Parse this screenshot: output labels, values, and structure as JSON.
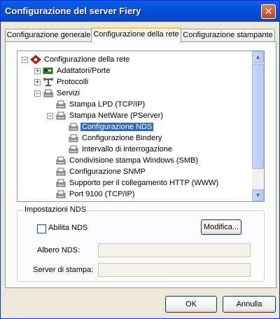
{
  "window": {
    "title": "Configurazione del server Fiery",
    "close_glyph": "✕"
  },
  "tabs": [
    {
      "label": "Configurazione generale"
    },
    {
      "label": "Configurazione della rete"
    },
    {
      "label": "Configurazione stampante"
    }
  ],
  "active_tab": 1,
  "tree": {
    "nodes": [
      {
        "label": "Configurazione della rete",
        "icon": "network-root-icon",
        "level": 0,
        "expander": "minus"
      },
      {
        "label": "Adattatori/Porte",
        "icon": "adapter-card-icon",
        "level": 1,
        "expander": "plus"
      },
      {
        "label": "Protocolli",
        "icon": "protocol-icon",
        "level": 1,
        "expander": "plus"
      },
      {
        "label": "Servizi",
        "icon": "services-icon",
        "level": 1,
        "expander": "minus"
      },
      {
        "label": "Stampa LPD (TCP/IP)",
        "icon": "printer-service-icon",
        "level": 2,
        "expander": ""
      },
      {
        "label": "Stampa NetWare (PServer)",
        "icon": "printer-service-icon",
        "level": 2,
        "expander": "minus"
      },
      {
        "label": "Configurazione NDS",
        "icon": "printer-service-icon",
        "level": 3,
        "expander": "",
        "selected": true
      },
      {
        "label": "Configurazione Bindery",
        "icon": "printer-service-icon",
        "level": 3,
        "expander": ""
      },
      {
        "label": "Intervallo di interrogazione",
        "icon": "printer-service-icon",
        "level": 3,
        "expander": ""
      },
      {
        "label": "Condivisione stampa Windows (SMB)",
        "icon": "printer-service-icon",
        "level": 2,
        "expander": ""
      },
      {
        "label": "Configurazione SNMP",
        "icon": "printer-service-icon",
        "level": 2,
        "expander": ""
      },
      {
        "label": "Supporto per il collegamento HTTP (WWW)",
        "icon": "printer-service-icon",
        "level": 2,
        "expander": ""
      },
      {
        "label": "Port 9100 (TCP/IP)",
        "icon": "printer-service-icon",
        "level": 2,
        "expander": ""
      }
    ]
  },
  "nds_settings": {
    "group_title": "Impostazioni NDS",
    "enable_label": "Abilita NDS",
    "enable_checked": false,
    "modify_button": "Modifica...",
    "tree_label": "Albero NDS:",
    "tree_value": "",
    "print_server_label": "Server di stampa:",
    "print_server_value": ""
  },
  "footer": {
    "ok_label": "OK",
    "cancel_label": "Annulla"
  }
}
